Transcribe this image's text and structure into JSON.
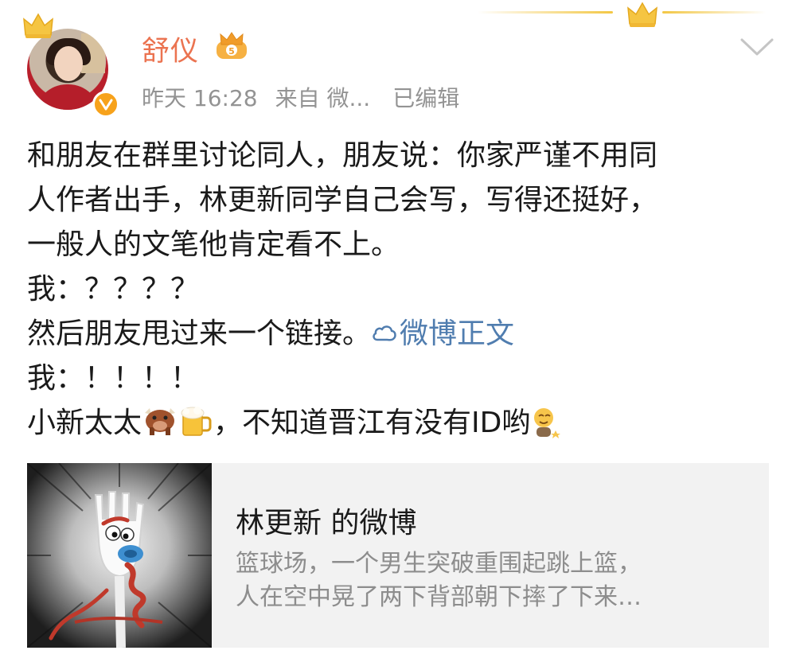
{
  "post": {
    "username": "舒仪",
    "timestamp": "昨天 16:28",
    "source": "来自 微...",
    "edited": "已编辑",
    "lines": [
      "和朋友在群里讨论同人，朋友说：你家严谨不用同",
      "人作者出手，林更新同学自己会写，写得还挺好，",
      "一般人的文笔他肯定看不上。",
      "我：？？？？",
      "然后朋友甩过来一个链接。",
      "我：！！！！",
      "小新太太",
      "，不知道晋江有没有ID哟"
    ],
    "link_text": "微博正文"
  },
  "card": {
    "title": "林更新 的微博",
    "desc_lines": [
      "篮球场，一个男生突破重围起跳上篮，",
      "人在空中晃了两下背部朝下摔了下来…"
    ]
  },
  "icons": {
    "verified": "verified-v-icon",
    "member": "member-crown-icon",
    "chevron": "chevron-down-icon",
    "link": "weibo-link-icon",
    "emoji_1": "ox-emoji",
    "emoji_2": "beer-emoji",
    "emoji_3": "shy-emoji"
  },
  "colors": {
    "username": "#eb7350",
    "meta": "#939393",
    "link": "#507daf",
    "card_bg": "#f2f2f2"
  }
}
